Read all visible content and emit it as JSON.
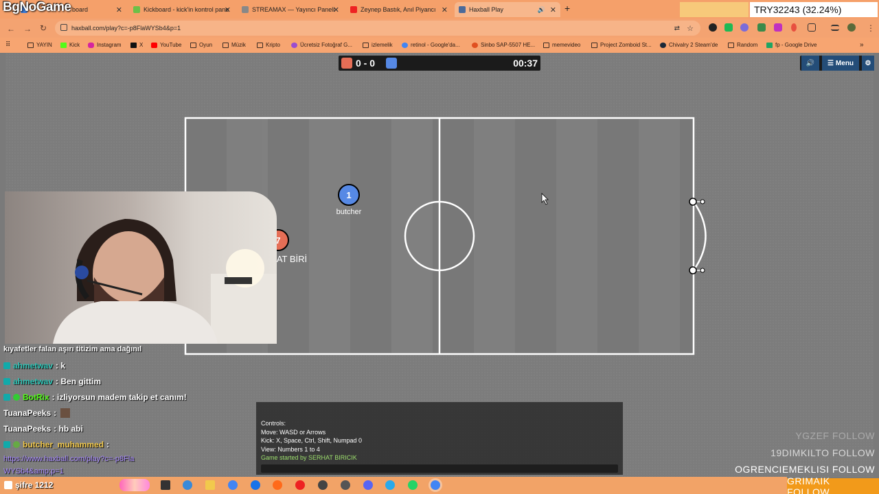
{
  "brand": "BgNoGame",
  "ticker": "TRY32243 (32.24%)",
  "tabs": [
    {
      "title": "board",
      "fav": "#3a7ad8"
    },
    {
      "title": "Kickboard - kick'in kontrol pane",
      "fav": "#6cc048"
    },
    {
      "title": "STREAMAX — Yayıncı Paneli",
      "fav": "#888888"
    },
    {
      "title": "Zeynep Bastık, Anıl Piyancı",
      "fav": "#e22222"
    },
    {
      "title": "Haxball Play",
      "fav": "#4a6a9a"
    }
  ],
  "url": "haxball.com/play?c=-p8FlaWYSb4&p=1",
  "bookmarks": [
    {
      "label": "YAYIN",
      "icon": "folder"
    },
    {
      "label": "Kick",
      "icon": "#53fc18"
    },
    {
      "label": "Instagram",
      "icon": "#d6249f"
    },
    {
      "label": "X",
      "icon": "#111111"
    },
    {
      "label": "YouTube",
      "icon": "#ff0000"
    },
    {
      "label": "Oyun",
      "icon": "folder"
    },
    {
      "label": "Müzik",
      "icon": "folder"
    },
    {
      "label": "Kripto",
      "icon": "folder"
    },
    {
      "label": "Ücretsiz Fotoğraf G...",
      "icon": "#9a4dd0"
    },
    {
      "label": "izlemelik",
      "icon": "folder"
    },
    {
      "label": "retinol - Google'da...",
      "icon": "#4285f4"
    },
    {
      "label": "Sinbo SAP-5507 HE...",
      "icon": "#e05020"
    },
    {
      "label": "memevideo",
      "icon": "folder"
    },
    {
      "label": "Project Zomboid St...",
      "icon": "folder"
    },
    {
      "label": "Chivalry 2 Steam'de",
      "icon": "#1b2838"
    },
    {
      "label": "Random",
      "icon": "folder"
    },
    {
      "label": "fp - Google Drive",
      "icon": "#1fa463"
    }
  ],
  "game": {
    "score": "0 - 0",
    "timer": "00:37",
    "menu_label": "Menu",
    "players": [
      {
        "number": "1",
        "name": "butcher",
        "team": "blue"
      },
      {
        "number": "7",
        "name": "AT BİRİ",
        "team": "red"
      }
    ],
    "controls": {
      "title": "Controls:",
      "move": "Move: WASD or Arrows",
      "kick": "Kick: X, Space, Ctrl, Shift, Numpad 0",
      "view": "View: Numbers 1 to 4",
      "log": "Game started by SERHAT BIRICIK"
    },
    "colors": {
      "red": "#e56e56",
      "blue": "#5689e5"
    }
  },
  "chat": [
    {
      "user": "",
      "text": "kıyafetler falan aşırı titizim ama dağınıl",
      "user_color": "#ffffff"
    },
    {
      "user": "ahmetwav",
      "text": ": k",
      "user_color": "#2ec4b6"
    },
    {
      "user": "ahmetwav",
      "text": ": Ben gittim",
      "user_color": "#2ec4b6"
    },
    {
      "user": "BotRix",
      "text": ": izliyorsun madem takip et canım!",
      "user_color": "#53fc18"
    },
    {
      "user": "TuanaPeeks",
      "text": ":",
      "user_color": "#ffffff"
    },
    {
      "user": "TuanaPeeks",
      "text": ": hb abi",
      "user_color": "#ffffff"
    },
    {
      "user": "butcher_muhammed",
      "text": ":",
      "user_color": "#f2c94c"
    }
  ],
  "chat_link": "https://www.haxball.com/play?c=-p8FlaWYSb4&amp;p=1",
  "followers": [
    "YGZEF  FOLLOW",
    "19DIMKILTO  FOLLOW",
    "OGRENCIEMEKLISI  FOLLOW",
    "GRIMAIK  FOLLOW"
  ],
  "password": "şifre 1212"
}
